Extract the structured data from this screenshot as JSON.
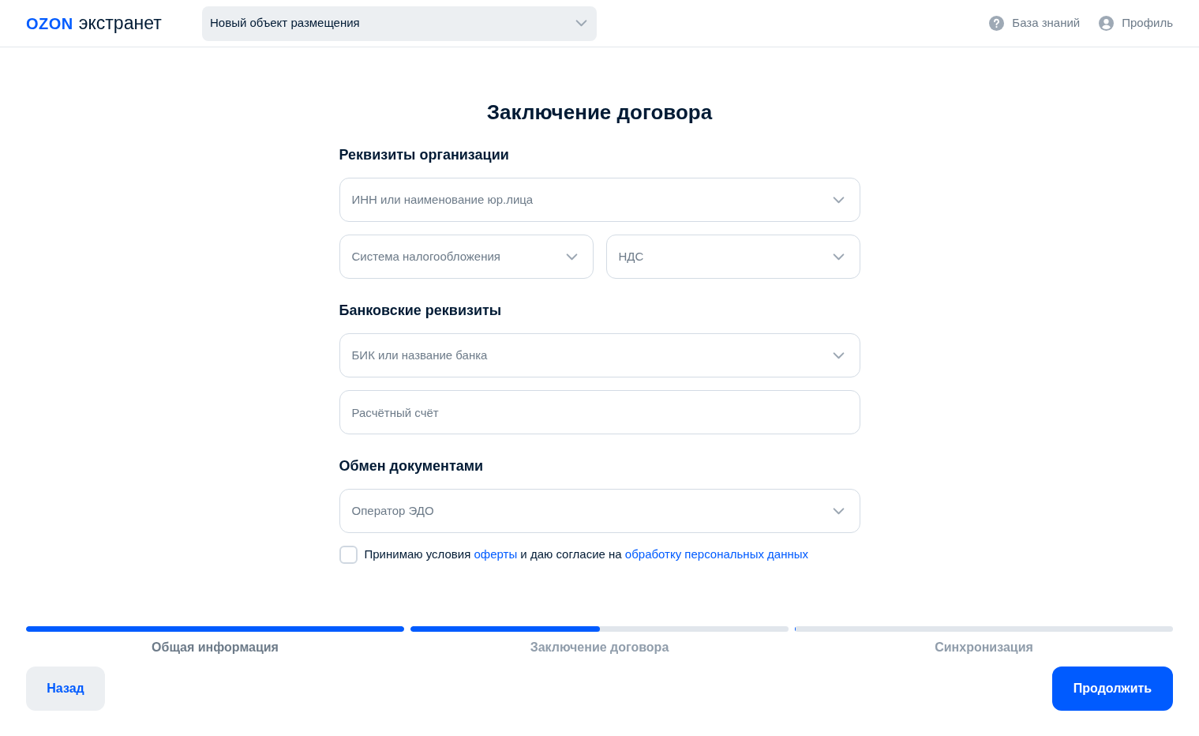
{
  "header": {
    "logo": {
      "brand": "OZON",
      "product": "экстранет"
    },
    "property_select": {
      "value": "Новый объект размещения"
    },
    "links": [
      {
        "kind": "help",
        "label": "База знаний"
      },
      {
        "kind": "profile",
        "label": "Профиль"
      }
    ]
  },
  "form": {
    "title": "Заключение договора",
    "sections": [
      {
        "heading": "Реквизиты организации",
        "rows": [
          [
            {
              "kind": "select",
              "placeholder": "ИНН или наименование юр.лица"
            }
          ],
          [
            {
              "kind": "select",
              "placeholder": "Система налогообложения"
            },
            {
              "kind": "select",
              "placeholder": "НДС"
            }
          ]
        ]
      },
      {
        "heading": "Банковские реквизиты",
        "rows": [
          [
            {
              "kind": "select",
              "placeholder": "БИК или название банка"
            }
          ],
          [
            {
              "kind": "input",
              "placeholder": "Расчётный счёт"
            }
          ]
        ]
      },
      {
        "heading": "Обмен документами",
        "rows": [
          [
            {
              "kind": "select",
              "placeholder": "Оператор ЭДО"
            }
          ]
        ]
      }
    ],
    "consent": {
      "checked": false,
      "parts": [
        {
          "kind": "text",
          "text": "Принимаю условия"
        },
        {
          "kind": "link",
          "text": "оферты"
        },
        {
          "kind": "text",
          "text": "и даю согласие на"
        },
        {
          "kind": "link",
          "text": "обработку персональных данных"
        }
      ]
    }
  },
  "steps": [
    {
      "label": "Общая информация",
      "level": 1
    },
    {
      "label": "Заключение договора",
      "level": 0.5
    },
    {
      "label": "Синхронизация",
      "level": 0
    }
  ],
  "buttons": {
    "back": "Назад",
    "next": "Продолжить"
  }
}
